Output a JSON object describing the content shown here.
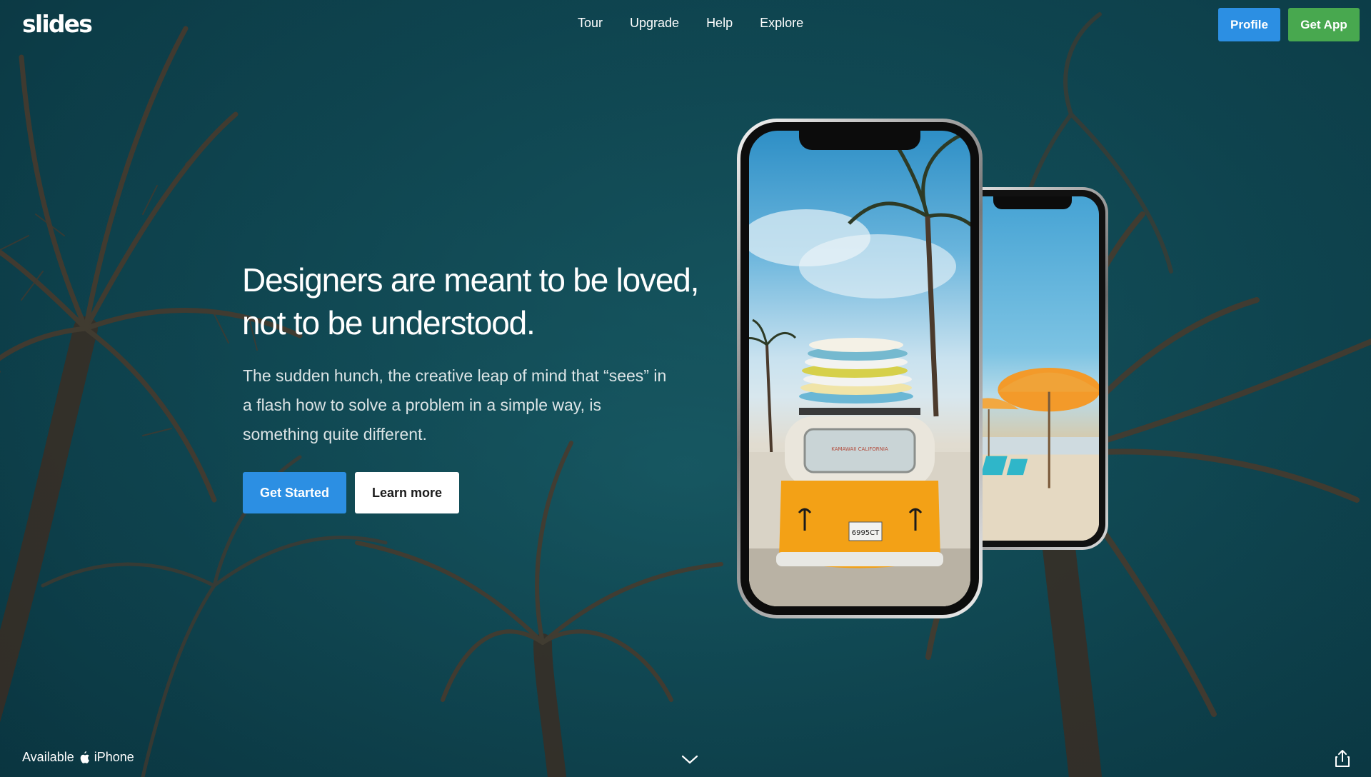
{
  "brand": {
    "logo": "slides"
  },
  "nav": {
    "items": [
      "Tour",
      "Upgrade",
      "Help",
      "Explore"
    ]
  },
  "header_buttons": {
    "profile": "Profile",
    "get_app": "Get App"
  },
  "hero": {
    "headline": "Designers are meant to be loved, not to be understood.",
    "subtext": "The sudden hunch, the creative leap of mind that “sees” in a flash how to solve a problem in a simple way, is something quite different.",
    "primary_cta": "Get Started",
    "secondary_cta": "Learn more"
  },
  "footer": {
    "available_prefix": "Available",
    "available_platform": "iPhone"
  },
  "phone_front_screen": {
    "van_badge": "KAMAWAII CALIFORNIA",
    "plate": "6995CT"
  },
  "colors": {
    "primary_blue": "#2c8fe3",
    "green": "#48a84f",
    "background": "#0f4651"
  },
  "icons": [
    "apple-icon",
    "chevron-down-icon",
    "share-icon"
  ]
}
